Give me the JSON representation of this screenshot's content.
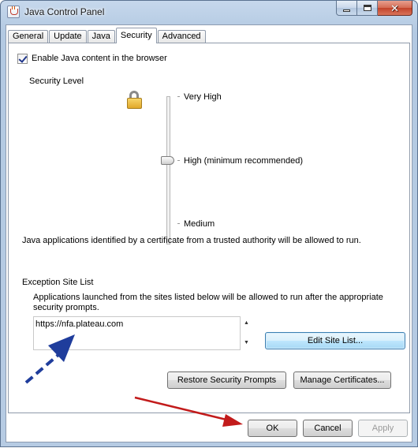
{
  "window": {
    "title": "Java Control Panel",
    "icon": "java-icon",
    "controls": {
      "minimize": "minimize-icon",
      "maximize": "maximize-icon",
      "close": "close-icon"
    }
  },
  "tabs": [
    {
      "label": "General",
      "active": false
    },
    {
      "label": "Update",
      "active": false
    },
    {
      "label": "Java",
      "active": false
    },
    {
      "label": "Security",
      "active": true
    },
    {
      "label": "Advanced",
      "active": false
    }
  ],
  "security": {
    "enable_checkbox": {
      "label": "Enable Java content in the browser",
      "checked": true
    },
    "level_heading": "Security Level",
    "lock_icon": "lock-icon",
    "levels": [
      "Very High",
      "High (minimum recommended)",
      "Medium"
    ],
    "selected_level": "High (minimum recommended)",
    "description": "Java applications identified by a certificate from a trusted authority will be allowed to run."
  },
  "exception": {
    "heading": "Exception Site List",
    "description_line1": "Applications launched from the sites listed below will be allowed to run after the appropriate",
    "description_line2": "security prompts.",
    "sites": [
      "https://nfa.plateau.com"
    ],
    "edit_button": "Edit Site List..."
  },
  "buttons": {
    "restore": "Restore Security Prompts",
    "manage_certs": "Manage Certificates...",
    "ok": "OK",
    "cancel": "Cancel",
    "apply": "Apply"
  },
  "annotations": {
    "blue_arrow_color": "#1f3d9c",
    "red_arrow_color": "#c21b1b"
  }
}
